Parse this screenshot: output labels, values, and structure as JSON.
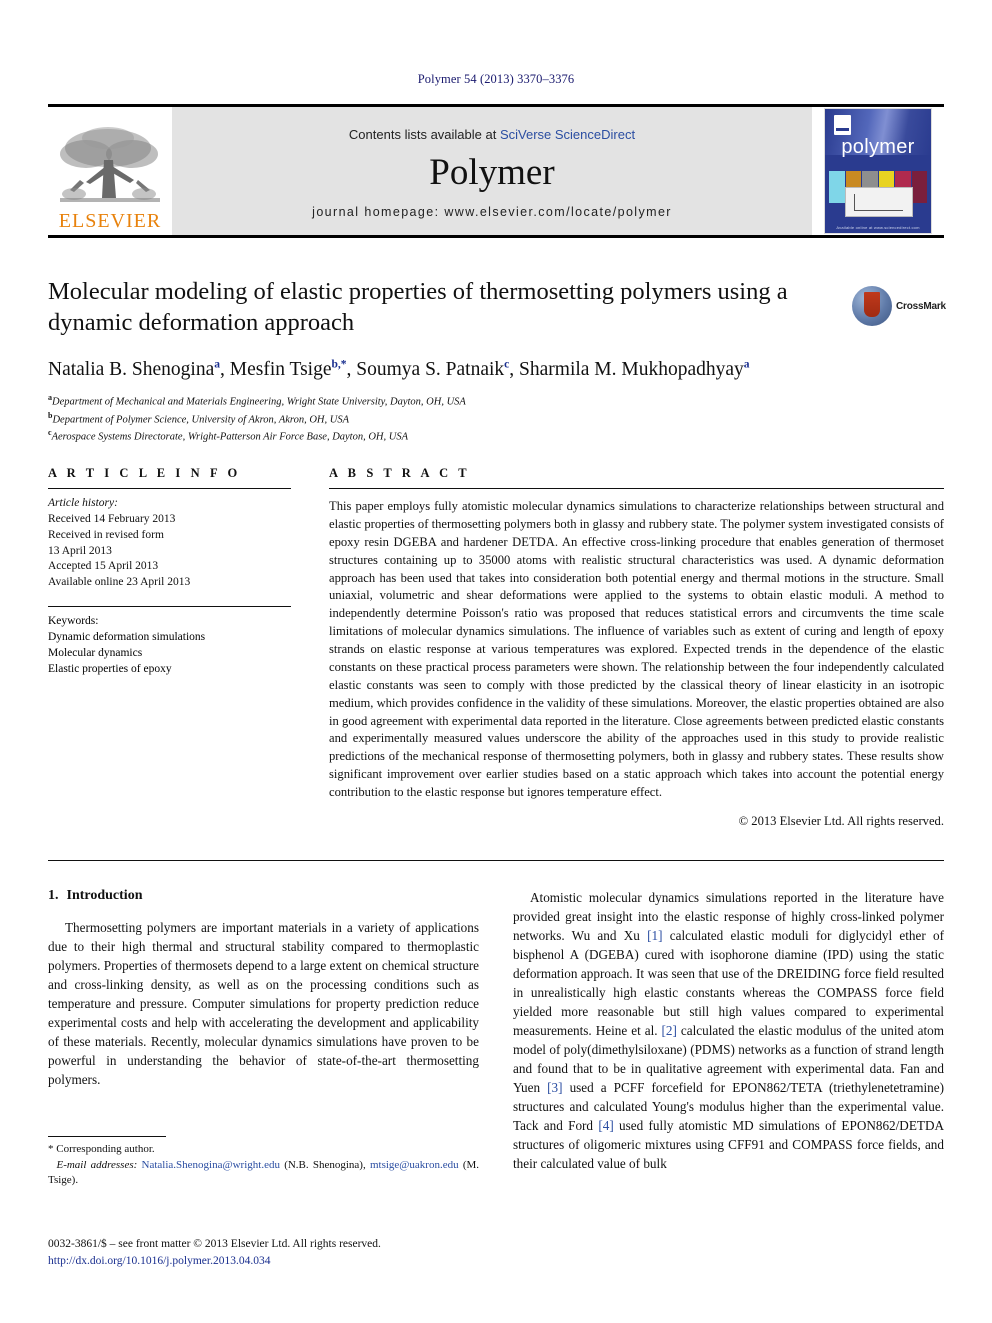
{
  "running_head": "Polymer 54 (2013) 3370–3376",
  "masthead": {
    "publisher_name": "ELSEVIER",
    "contents_prefix": "Contents lists available at ",
    "contents_link": "SciVerse ScienceDirect",
    "journal_name": "Polymer",
    "homepage_line": "journal homepage: www.elsevier.com/locate/polymer",
    "cover": {
      "title": "polymer",
      "footer_text": "Available online at www.sciencedirect.com"
    }
  },
  "article": {
    "title": "Molecular modeling of elastic properties of thermosetting polymers using a dynamic deformation approach",
    "crossmark_label": "CrossMark",
    "authors": [
      {
        "name": "Natalia B. Shenogina",
        "marks": "a"
      },
      {
        "name": "Mesfin Tsige",
        "marks": "b,*"
      },
      {
        "name": "Soumya S. Patnaik",
        "marks": "c"
      },
      {
        "name": "Sharmila M. Mukhopadhyay",
        "marks": "a"
      }
    ],
    "affiliations": [
      {
        "mark": "a",
        "text": "Department of Mechanical and Materials Engineering, Wright State University, Dayton, OH, USA"
      },
      {
        "mark": "b",
        "text": "Department of Polymer Science, University of Akron, Akron, OH, USA"
      },
      {
        "mark": "c",
        "text": "Aerospace Systems Directorate, Wright-Patterson Air Force Base, Dayton, OH, USA"
      }
    ]
  },
  "article_info": {
    "heading": "A R T I C L E   I N F O",
    "history_label": "Article history:",
    "history": [
      "Received 14 February 2013",
      "Received in revised form",
      "13 April 2013",
      "Accepted 15 April 2013",
      "Available online 23 April 2013"
    ],
    "keywords_label": "Keywords:",
    "keywords": [
      "Dynamic deformation simulations",
      "Molecular dynamics",
      "Elastic properties of epoxy"
    ]
  },
  "abstract": {
    "heading": "A B S T R A C T",
    "text": "This paper employs fully atomistic molecular dynamics simulations to characterize relationships between structural and elastic properties of thermosetting polymers both in glassy and rubbery state. The polymer system investigated consists of epoxy resin DGEBA and hardener DETDA. An effective cross-linking procedure that enables generation of thermoset structures containing up to 35000 atoms with realistic structural characteristics was used. A dynamic deformation approach has been used that takes into consideration both potential energy and thermal motions in the structure. Small uniaxial, volumetric and shear deformations were applied to the systems to obtain elastic moduli. A method to independently determine Poisson's ratio was proposed that reduces statistical errors and circumvents the time scale limitations of molecular dynamics simulations. The influence of variables such as extent of curing and length of epoxy strands on elastic response at various temperatures was explored. Expected trends in the dependence of the elastic constants on these practical process parameters were shown. The relationship between the four independently calculated elastic constants was seen to comply with those predicted by the classical theory of linear elasticity in an isotropic medium, which provides confidence in the validity of these simulations. Moreover, the elastic properties obtained are also in good agreement with experimental data reported in the literature. Close agreements between predicted elastic constants and experimentally measured values underscore the ability of the approaches used in this study to provide realistic predictions of the mechanical response of thermosetting polymers, both in glassy and rubbery states. These results show significant improvement over earlier studies based on a static approach which takes into account the potential energy contribution to the elastic response but ignores temperature effect.",
    "copyright": "© 2013 Elsevier Ltd. All rights reserved."
  },
  "body": {
    "section_number": "1.",
    "section_title": "Introduction",
    "left_paragraph": "Thermosetting polymers are important materials in a variety of applications due to their high thermal and structural stability compared to thermoplastic polymers. Properties of thermosets depend to a large extent on chemical structure and cross-linking density, as well as on the processing conditions such as temperature and pressure. Computer simulations for property prediction reduce experimental costs and help with accelerating the development and applicability of these materials. Recently, molecular dynamics simulations have proven to be powerful in understanding the behavior of state-of-the-art thermosetting polymers.",
    "right_paragraph_parts": [
      {
        "t": "Atomistic molecular dynamics simulations reported in the literature have provided great insight into the elastic response of highly cross-linked polymer networks. Wu and Xu "
      },
      {
        "t": "[1]",
        "ref": true
      },
      {
        "t": " calculated elastic moduli for diglycidyl ether of bisphenol A (DGEBA) cured with isophorone diamine (IPD) using the static deformation approach. It was seen that use of the DREIDING force field resulted in unrealistically high elastic constants whereas the COMPASS force field yielded more reasonable but still high values compared to experimental measurements. Heine et al. "
      },
      {
        "t": "[2]",
        "ref": true
      },
      {
        "t": " calculated the elastic modulus of the united atom model of poly(dimethylsiloxane) (PDMS) networks as a function of strand length and found that to be in qualitative agreement with experimental data. Fan and Yuen "
      },
      {
        "t": "[3]",
        "ref": true
      },
      {
        "t": " used a PCFF forcefield for EPON862/TETA (triethylenetetramine) structures and calculated Young's modulus higher than the experimental value. Tack and Ford "
      },
      {
        "t": "[4]",
        "ref": true
      },
      {
        "t": " used fully atomistic MD simulations of EPON862/DETDA structures of oligomeric mixtures using CFF91 and COMPASS force fields, and their calculated value of bulk"
      }
    ]
  },
  "footnote": {
    "corresponding_author": "* Corresponding author.",
    "email_label": "E-mail addresses:",
    "email_1": "Natalia.Shenogina@wright.edu",
    "email_1_owner": "(N.B. Shenogina),",
    "email_2": "mtsige@uakron.edu",
    "email_2_owner": "(M. Tsige)."
  },
  "page_footer": {
    "issn_line": "0032-3861/$ – see front matter © 2013 Elsevier Ltd. All rights reserved.",
    "doi": "http://dx.doi.org/10.1016/j.polymer.2013.04.034"
  },
  "colors": {
    "link": "#2b4ea2",
    "elsevier_orange": "#E8820C",
    "journal_blue": "#2a3b8f",
    "running_head": "#1a1a6e"
  }
}
